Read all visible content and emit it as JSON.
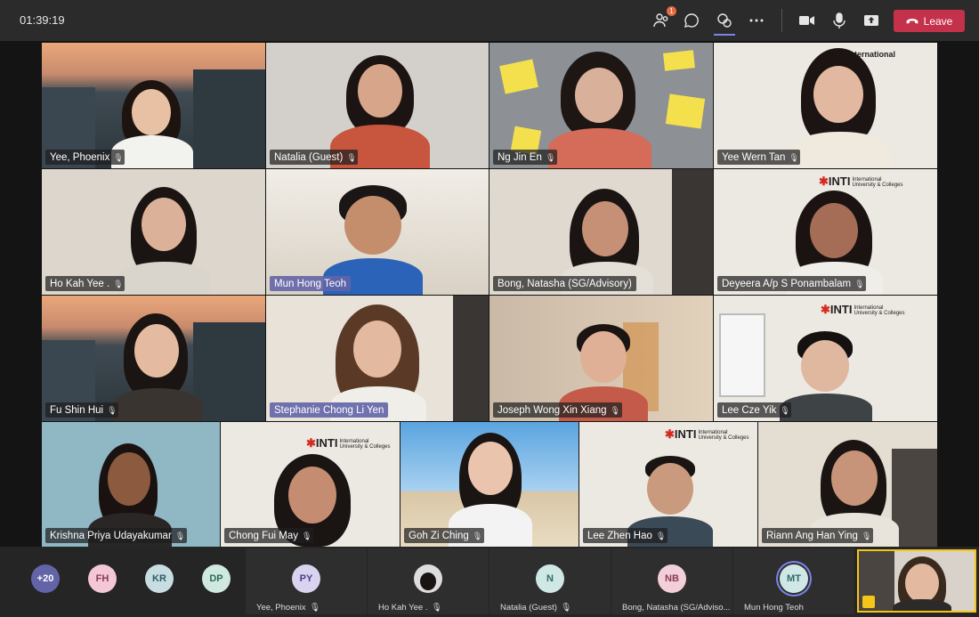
{
  "toolbar": {
    "timer": "01:39:19",
    "participants_badge": "1",
    "leave_label": "Leave",
    "icons": [
      "people-icon",
      "chat-icon",
      "reactions-icon",
      "more-icon",
      "camera-icon",
      "mic-icon",
      "share-icon",
      "phone-icon"
    ],
    "accent": "#7b83eb",
    "leave_color": "#c4314b"
  },
  "grid": [
    {
      "name": "Yee, Phoenix",
      "highlight": false
    },
    {
      "name": "Natalia (Guest)",
      "highlight": false
    },
    {
      "name": "Ng Jin En",
      "highlight": false
    },
    {
      "name": "Yee Wern Tan",
      "highlight": false
    },
    {
      "name": "Ho Kah Yee .",
      "highlight": false
    },
    {
      "name": "Mun Hong Teoh",
      "highlight": true
    },
    {
      "name": "Bong, Natasha (SG/Advisory)",
      "highlight": false
    },
    {
      "name": "Deyeera A/p S Ponambalam",
      "highlight": false
    },
    {
      "name": "Fu Shin Hui",
      "highlight": false
    },
    {
      "name": "Stephanie Chong Li Yen",
      "highlight": true
    },
    {
      "name": "Joseph Wong Xin Xiang",
      "highlight": false
    },
    {
      "name": "Lee Cze Yik",
      "highlight": false
    },
    {
      "name": "Krishna Priya Udayakumar",
      "highlight": false
    },
    {
      "name": "Chong Fui May",
      "highlight": false
    },
    {
      "name": "Goh Zi Ching",
      "highlight": false
    },
    {
      "name": "Lee Zhen Hao",
      "highlight": false
    },
    {
      "name": "Riann Ang Han Ying",
      "highlight": false
    }
  ],
  "inti_logo": {
    "brand": "INTI",
    "line1": "International",
    "line2": "University & Colleges"
  },
  "overflow": [
    {
      "initials": "+20",
      "color": "#6264a7"
    },
    {
      "initials": "FH",
      "color": "#f3c7d6"
    },
    {
      "initials": "KR",
      "color": "#c8dde2"
    },
    {
      "initials": "DP",
      "color": "#cfe8e0"
    }
  ],
  "bottom_row": [
    {
      "initials": "PY",
      "name": "Yee, Phoenix",
      "color": "#d9d3f0"
    },
    {
      "initials": "",
      "name": "Ho Kah Yee .",
      "color": "#444"
    },
    {
      "initials": "N",
      "name": "Natalia (Guest)",
      "color": "#cfe8e6"
    },
    {
      "initials": "NB",
      "name": "Bong, Natasha (SG/Adviso...",
      "color": "#f3cfd9"
    },
    {
      "initials": "MT",
      "name": "Mun Hong Teoh",
      "color": "#cfe8e6"
    }
  ]
}
